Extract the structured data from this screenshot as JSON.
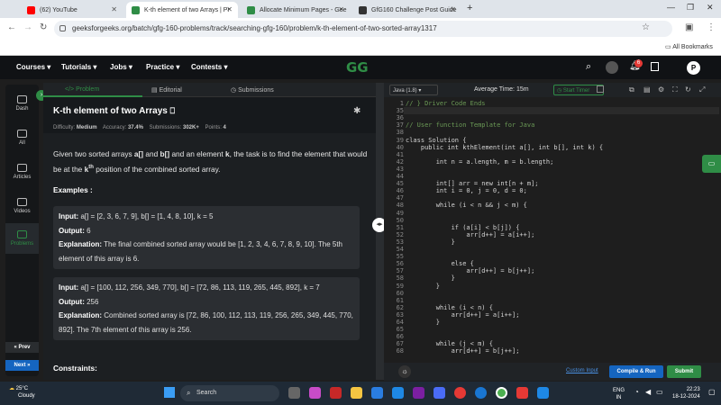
{
  "browser": {
    "tabs": [
      {
        "label": "(62) YouTube",
        "color": "#ff0000"
      },
      {
        "label": "K-th element of two Arrays | Pr",
        "color": "#2f8d46"
      },
      {
        "label": "Allocate Minimum Pages - Gee",
        "color": "#2f8d46"
      },
      {
        "label": "GfG160 Challenge Post Guide",
        "color": "#333333"
      }
    ],
    "url": "geeksforgeeks.org/batch/gfg-160-problems/track/searching-gfg-160/problem/k-th-element-of-two-sorted-array1317",
    "bookmarks_label": "All Bookmarks"
  },
  "site": {
    "nav": [
      "Courses",
      "Tutorials",
      "Jobs",
      "Practice",
      "Contests"
    ],
    "logo": "GG",
    "notif_count": "6",
    "avatar": "P"
  },
  "sidebar": {
    "items": [
      "Dash",
      "All",
      "Articles",
      "Videos",
      "Problems"
    ],
    "prev": "Prev",
    "next": "Next"
  },
  "problem": {
    "tabs": [
      "Problem",
      "Editorial",
      "Submissions"
    ],
    "title": "K-th element of two Arrays",
    "difficulty_label": "Difficulty:",
    "difficulty": "Medium",
    "accuracy_label": "Accuracy:",
    "accuracy": "37.4%",
    "subs_label": "Submissions:",
    "submissions": "302K+",
    "points_label": "Points:",
    "points": "4",
    "statement_p1": "Given two sorted arrays ",
    "a": "a[]",
    "and": " and ",
    "b": "b[]",
    "statement_p2": " and an element ",
    "k": "k",
    "statement_p3": ", the task is to find the element that would be at the ",
    "kth": "k",
    "th": "th",
    "statement_p4": " position of the combined sorted array.",
    "examples_heading": "Examples :",
    "ex1_input_label": "Input:",
    "ex1_input": " a[] = [2, 3, 6, 7, 9], b[] = [1, 4, 8, 10], k = 5",
    "ex1_output_label": "Output:",
    "ex1_output": " 6",
    "ex1_expl_label": "Explanation:",
    "ex1_expl": " The final combined sorted array would be [1, 2, 3, 4, 6, 7, 8, 9, 10]. The 5th element of this array is 6.",
    "ex2_input_label": "Input:",
    "ex2_input": " a[] = [100, 112, 256, 349, 770], b[] = [72, 86, 113, 119, 265, 445, 892], k = 7",
    "ex2_output_label": "Output:",
    "ex2_output": " 256",
    "ex2_expl_label": "Explanation:",
    "ex2_expl": " Combined sorted array is [72, 86, 100, 112, 113, 119, 256, 265, 349, 445, 770, 892]. The 7th element of this array is 256.",
    "constraints_heading": "Constraints:"
  },
  "editor": {
    "language": "Java (1.8)",
    "avg_time": "Average Time: 15m",
    "start_timer": "Start Timer",
    "lines": [
      {
        "n": "1",
        "t": "// } Driver Code Ends",
        "c": "cm"
      },
      {
        "n": "35",
        "t": "",
        "c": ""
      },
      {
        "n": "36",
        "t": "",
        "c": ""
      },
      {
        "n": "37",
        "t": "// User function Template for Java",
        "c": "cm"
      },
      {
        "n": "38",
        "t": "",
        "c": ""
      },
      {
        "n": "39",
        "t": "class Solution {",
        "c": ""
      },
      {
        "n": "40",
        "t": "    public int kthElement(int a[], int b[], int k) {",
        "c": ""
      },
      {
        "n": "41",
        "t": "",
        "c": ""
      },
      {
        "n": "42",
        "t": "        int n = a.length, m = b.length;",
        "c": ""
      },
      {
        "n": "43",
        "t": "",
        "c": ""
      },
      {
        "n": "44",
        "t": "",
        "c": ""
      },
      {
        "n": "45",
        "t": "        int[] arr = new int[n + m];",
        "c": ""
      },
      {
        "n": "46",
        "t": "        int i = 0, j = 0, d = 0;",
        "c": ""
      },
      {
        "n": "47",
        "t": "",
        "c": ""
      },
      {
        "n": "48",
        "t": "        while (i < n && j < m) {",
        "c": ""
      },
      {
        "n": "49",
        "t": "",
        "c": ""
      },
      {
        "n": "50",
        "t": "",
        "c": ""
      },
      {
        "n": "51",
        "t": "            if (a[i] < b[j]) {",
        "c": ""
      },
      {
        "n": "52",
        "t": "                arr[d++] = a[i++];",
        "c": ""
      },
      {
        "n": "53",
        "t": "            }",
        "c": ""
      },
      {
        "n": "54",
        "t": "",
        "c": ""
      },
      {
        "n": "55",
        "t": "",
        "c": ""
      },
      {
        "n": "56",
        "t": "            else {",
        "c": ""
      },
      {
        "n": "57",
        "t": "                arr[d++] = b[j++];",
        "c": ""
      },
      {
        "n": "58",
        "t": "            }",
        "c": ""
      },
      {
        "n": "59",
        "t": "        }",
        "c": ""
      },
      {
        "n": "60",
        "t": "",
        "c": ""
      },
      {
        "n": "61",
        "t": "",
        "c": ""
      },
      {
        "n": "62",
        "t": "        while (i < n) {",
        "c": ""
      },
      {
        "n": "63",
        "t": "            arr[d++] = a[i++];",
        "c": ""
      },
      {
        "n": "64",
        "t": "        }",
        "c": ""
      },
      {
        "n": "65",
        "t": "",
        "c": ""
      },
      {
        "n": "66",
        "t": "",
        "c": ""
      },
      {
        "n": "67",
        "t": "        while (j < m) {",
        "c": ""
      },
      {
        "n": "68",
        "t": "            arr[d++] = b[j++];",
        "c": ""
      }
    ],
    "custom_input": "Custom Input",
    "compile_run": "Compile & Run",
    "submit": "Submit"
  },
  "taskbar": {
    "weather_temp": "25°C",
    "weather_desc": "Cloudy",
    "search": "Search",
    "lang1": "ENG",
    "lang2": "IN",
    "time": "22:23",
    "date": "18-12-2024"
  }
}
